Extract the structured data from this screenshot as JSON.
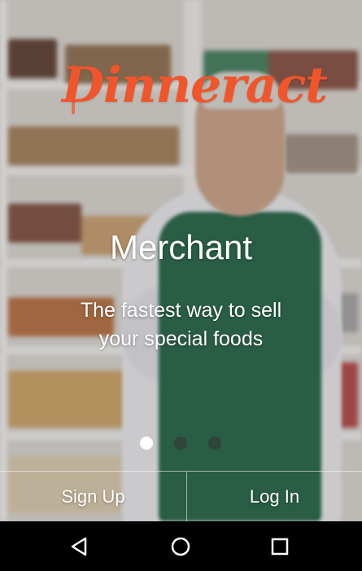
{
  "app": {
    "logo_text": "Dinneract"
  },
  "onboarding": {
    "title": "Merchant",
    "tagline": "The fastest way to sell your special foods",
    "page_indicator": {
      "current": 1,
      "total": 3
    }
  },
  "actions": {
    "sign_up_label": "Sign Up",
    "log_in_label": "Log In"
  },
  "system_nav": {
    "back_icon": "back-triangle-icon",
    "home_icon": "home-circle-icon",
    "recents_icon": "recents-square-icon"
  },
  "colors": {
    "brand": "#f0552b",
    "text": "#ffffff",
    "navbar": "#000000"
  }
}
